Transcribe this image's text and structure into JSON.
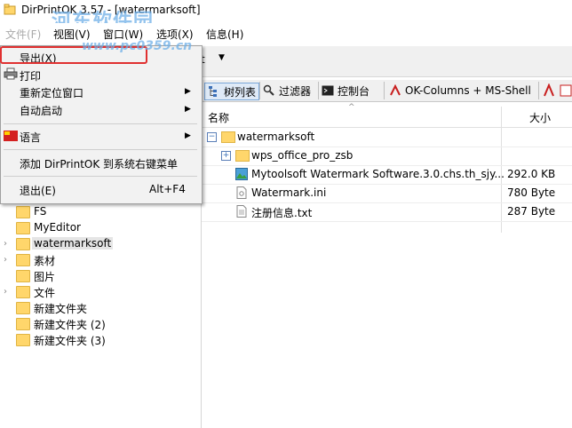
{
  "window": {
    "title": "DirPrintOK 3.57 - [watermarksoft]"
  },
  "watermark": {
    "site_name": "河东软件园",
    "url": "www.pc0359.cn"
  },
  "menubar": [
    {
      "label": "文件(F)"
    },
    {
      "label": "视图(V)"
    },
    {
      "label": "窗口(W)"
    },
    {
      "label": "选项(X)"
    },
    {
      "label": "信息(H)"
    }
  ],
  "context_menu": {
    "items": [
      {
        "label": "导出(X)"
      },
      {
        "label": "打印"
      },
      {
        "label": "重新定位窗口"
      },
      {
        "label": "自动启动"
      },
      {
        "label": "语言"
      },
      {
        "label": "添加 DirPrintOK 到系统右键菜单"
      },
      {
        "label": "退出(E)",
        "shortcut": "Alt+F4"
      }
    ]
  },
  "toolbar": {
    "tree_list": "树列表",
    "filter": "过滤器",
    "console": "控制台",
    "columns": "OK-Columns + MS-Shell",
    "partial_t": "t"
  },
  "list": {
    "columns": {
      "name": "名称",
      "size": "大小"
    },
    "rows": [
      {
        "name": "watermarksoft",
        "size": ""
      },
      {
        "name": "wps_office_pro_zsb",
        "size": ""
      },
      {
        "name": "Mytoolsoft Watermark Software.3.0.chs.th_sjy...",
        "size": "292.0 KB"
      },
      {
        "name": "Watermark.ini",
        "size": "780 Byte"
      },
      {
        "name": "注册信息.txt",
        "size": "287 Byte"
      }
    ]
  },
  "tree": {
    "items": [
      {
        "label": "FS"
      },
      {
        "label": "MyEditor"
      },
      {
        "label": "watermarksoft"
      },
      {
        "label": "素材"
      },
      {
        "label": "图片"
      },
      {
        "label": "文件"
      },
      {
        "label": "新建文件夹"
      },
      {
        "label": "新建文件夹 (2)"
      },
      {
        "label": "新建文件夹 (3)"
      }
    ]
  },
  "colors": {
    "accent_red": "#e03030",
    "folder": "#ffd66b",
    "watermark_blue": "#6fb0e8"
  }
}
